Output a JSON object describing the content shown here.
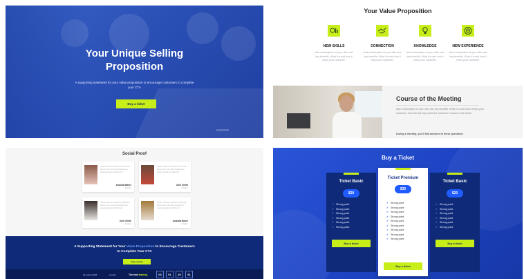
{
  "hero": {
    "title_line1": "Your Unique Selling",
    "title_line2": "Proposition",
    "subtitle": "A supporting statement for your value proposition to encourage customers to complete your CTA",
    "cta_label": "Buy a ticket"
  },
  "value": {
    "title": "Your Value Proposition",
    "items": [
      {
        "title": "NEW SKILLS",
        "desc": "Add a description of your offer and key benefits. What it is and how it helps your customer.",
        "icon": "gear-chart-icon"
      },
      {
        "title": "CONNECTION",
        "desc": "Add a description of your offer and key benefits. What it is and how it helps your customer.",
        "icon": "handshake-icon"
      },
      {
        "title": "KNOWLEDGE",
        "desc": "Add a description of your offer and key benefits. What it is and how it helps your customer.",
        "icon": "lightbulb-icon"
      },
      {
        "title": "NEW EXPERIENCE",
        "desc": "Add a description of your offer and key benefits. What it is and how it helps your customer.",
        "icon": "target-icon"
      }
    ]
  },
  "course": {
    "title": "Course of the Meeting",
    "desc": "Add a description of your offer and key benefits. What it is and how it helps your customer. How will this help solve the customer's issues in the future.",
    "desc2": "During a meeting, you'll find answers to these questions:"
  },
  "social": {
    "title": "Social Proof",
    "cards": [
      {
        "quote": "\"Write customer reviews to show that they're real. Use short quotes from several people to build trust.\"",
        "name": "Amanda Baker",
        "role": "Position"
      },
      {
        "quote": "\"Write customer reviews to show that they're real. Use short quotes from several people to build trust.\"",
        "name": "John Smith",
        "role": "Position"
      },
      {
        "quote": "\"Write customer reviews to show that they're real. Use short quotes from several people to build trust.\"",
        "name": "John Smith",
        "role": "Position"
      },
      {
        "quote": "\"Write customer reviews to show that they're real. Use short quotes from several people to build trust.\"",
        "name": "Amanda Baker",
        "role": "Position"
      }
    ]
  },
  "cta_strip": {
    "statement_pre": "A Supporting Statement for Your ",
    "statement_hl": "Value Proposition",
    "statement_post": " to Encourage Customers",
    "statement_line2": "to Complete Your CTA",
    "button": "Buy a ticket",
    "date": "23 march 2018",
    "location": "London",
    "next_pre": "The next ",
    "next_hl": "training",
    "countdown": [
      "03",
      "01",
      "20",
      "51"
    ]
  },
  "tickets": {
    "title": "Buy a Ticket",
    "plans": [
      {
        "name": "Ticket Basic",
        "price": "$20",
        "features": [
          "Strong point",
          "Strong point",
          "Strong point",
          "Strong point",
          "Strong point",
          "Strong point"
        ],
        "button": "Buy a ticket"
      },
      {
        "name": "Ticket Premium",
        "price": "$30",
        "features": [
          "Strong point",
          "Strong point",
          "Strong point",
          "Strong point",
          "Strong point",
          "Strong point",
          "Strong point",
          "Strong point",
          "Strong point"
        ],
        "button": "Buy a ticket"
      },
      {
        "name": "Ticket Basic",
        "price": "$20",
        "features": [
          "Strong point",
          "Strong point",
          "Strong point",
          "Strong point",
          "Strong point",
          "Strong point"
        ],
        "button": "Buy a ticket"
      }
    ]
  },
  "colors": {
    "accent": "#c8ee1a",
    "brand_blue": "#1f44c4",
    "dark_navy": "#0f2a78"
  }
}
